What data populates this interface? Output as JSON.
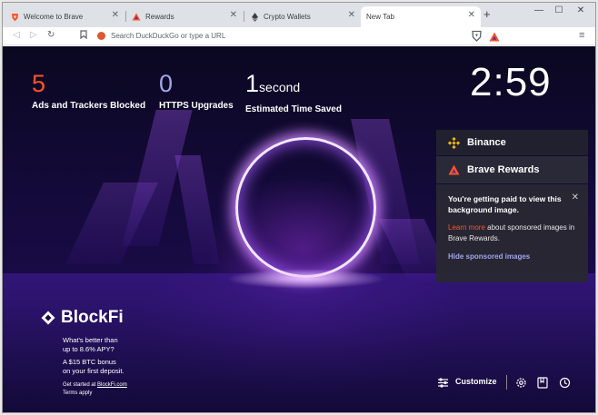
{
  "tabs": [
    {
      "label": "Welcome to Brave",
      "icon": "brave-lion-icon",
      "active": false
    },
    {
      "label": "Rewards",
      "icon": "brave-rewards-triangle-icon",
      "active": false
    },
    {
      "label": "Crypto Wallets",
      "icon": "ethereum-icon",
      "active": false
    },
    {
      "label": "New Tab",
      "icon": "",
      "active": true
    }
  ],
  "toolbar": {
    "url_placeholder": "Search DuckDuckGo or type a URL"
  },
  "stats": {
    "ads_blocked": {
      "value": "5",
      "label": "Ads and Trackers Blocked"
    },
    "https_upgrades": {
      "value": "0",
      "label": "HTTPS Upgrades"
    },
    "time_saved": {
      "value": "1",
      "unit": "second",
      "label": "Estimated Time Saved"
    }
  },
  "clock": "2:59",
  "widgets": {
    "binance": "Binance",
    "brave_rewards": "Brave Rewards"
  },
  "popup": {
    "title": "You're getting paid to view this background image.",
    "link": "Learn more",
    "body": " about sponsored images in Brave Rewards.",
    "hide": "Hide sponsored images"
  },
  "sponsor": {
    "name": "BlockFi",
    "line1": "What's better than",
    "line2": "up to 8.6% APY?",
    "line3": "A $15 BTC bonus",
    "line4": "on your first deposit.",
    "cta_prefix": "Get started at ",
    "cta_link": "BlockFi.com",
    "terms": "Terms apply"
  },
  "footer": {
    "customize": "Customize"
  },
  "colors": {
    "stat_accent": "#fb542b",
    "stat_blue": "#a0a5eb",
    "brave_orange": "#fb542b"
  }
}
